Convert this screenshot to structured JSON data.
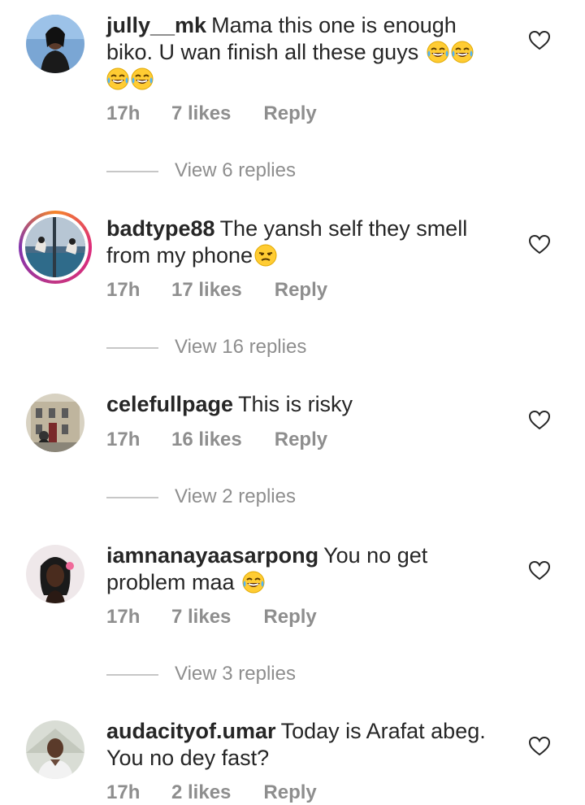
{
  "comments": [
    {
      "username": "jully__mk",
      "text_line1": "Mama this one is enough",
      "text_line2": "biko. U wan finish all these guys",
      "time": "17h",
      "likes": "7 likes",
      "reply": "Reply",
      "view_replies": "View 6 replies",
      "emojis": [
        "face-with-tears-of-joy",
        "face-with-tears-of-joy",
        "face-with-tears-of-joy",
        "face-with-tears-of-joy"
      ]
    },
    {
      "username": "badtype88",
      "text_line1": "The yansh self they smell",
      "text_line2": "from my phone",
      "time": "17h",
      "likes": "17 likes",
      "reply": "Reply",
      "view_replies": "View 16 replies",
      "emojis": [
        "unamused-face"
      ],
      "has_story_ring": true
    },
    {
      "username": "celefullpage",
      "text_line1": "This is risky",
      "time": "17h",
      "likes": "16 likes",
      "reply": "Reply",
      "view_replies": "View 2 replies"
    },
    {
      "username": "iamnanayaasarpong",
      "text_line1": "You no get",
      "text_line2": "problem maa",
      "time": "17h",
      "likes": "7 likes",
      "reply": "Reply",
      "view_replies": "View 3 replies",
      "emojis": [
        "face-with-tears-of-joy"
      ]
    },
    {
      "username": "audacityof.umar",
      "text_line1": "Today is Arafat abeg.",
      "text_line2": "You no dey fast?",
      "time": "17h",
      "likes": "2 likes",
      "reply": "Reply"
    }
  ],
  "colors": {
    "text": "#262626",
    "meta": "#8e8e8e",
    "divider": "#c7c7c7",
    "story_ring": [
      "#f58529",
      "#dd2a7b",
      "#8134af"
    ]
  },
  "icons": {
    "like": "heart-outline-icon"
  }
}
